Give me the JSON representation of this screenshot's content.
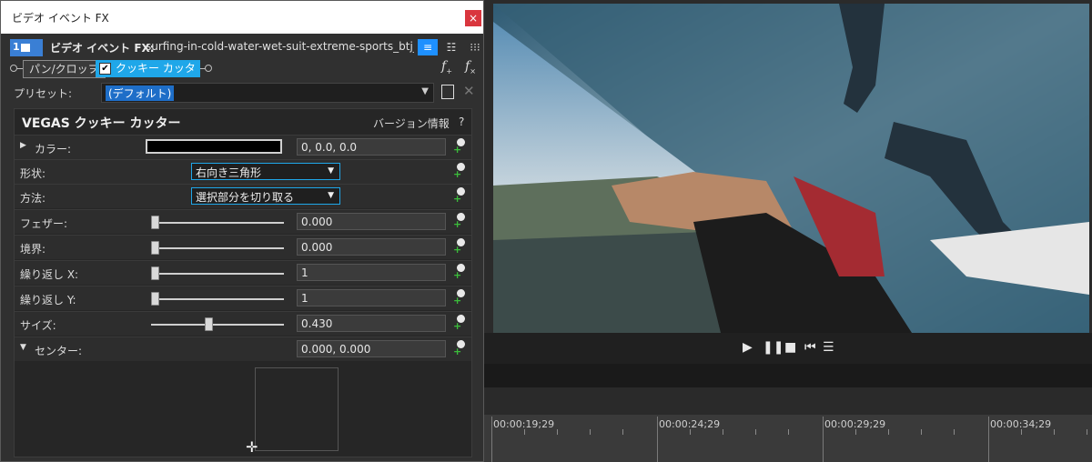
{
  "window": {
    "title": "ビデオ イベント FX",
    "close_glyph": "×"
  },
  "chain": {
    "track_number": "1",
    "label": "ビデオ イベント FX:",
    "media_name": "surfing-in-cold-water-wet-suit-extreme-sports_btj_tyvx",
    "view_buttons": [
      "list-view-icon",
      "grid-view-icon",
      "grid-view-alt-icon"
    ]
  },
  "plugins": {
    "pan_crop": "パン/クロップ",
    "cookie_cutter": "クッキー カッター",
    "cookie_enabled": true,
    "add_fx_icon": "fx-add-icon",
    "remove_fx_icon": "fx-remove-icon"
  },
  "preset": {
    "label": "プリセット:",
    "value": "(デフォルト)"
  },
  "plugin_panel": {
    "name": "VEGAS クッキー カッター",
    "about": "バージョン情報",
    "help": "?",
    "params": {
      "color": {
        "label": "カラー:",
        "value": "0, 0.0, 0.0",
        "swatch": "#000000"
      },
      "shape": {
        "label": "形状:",
        "value": "右向き三角形"
      },
      "method": {
        "label": "方法:",
        "value": "選択部分を切り取る"
      },
      "feather": {
        "label": "フェザー:",
        "value": "0.000",
        "level": 0.0
      },
      "border": {
        "label": "境界:",
        "value": "0.000",
        "level": 0.0
      },
      "repeat_x": {
        "label": "繰り返し X:",
        "value": "1",
        "level": 0.0
      },
      "repeat_y": {
        "label": "繰り返し Y:",
        "value": "1",
        "level": 0.0
      },
      "size": {
        "label": "サイズ:",
        "value": "0.430",
        "level": 0.43
      },
      "center": {
        "label": "センター:",
        "value": "0.000, 0.000"
      }
    }
  },
  "timeline": {
    "timecodes": [
      "00:00:19;29",
      "00:00:24;29",
      "00:00:29;29",
      "00:00:34;29"
    ]
  },
  "colors": {
    "accent": "#1fa7e9",
    "close": "#d9363e",
    "selection": "#1e6ec8"
  }
}
